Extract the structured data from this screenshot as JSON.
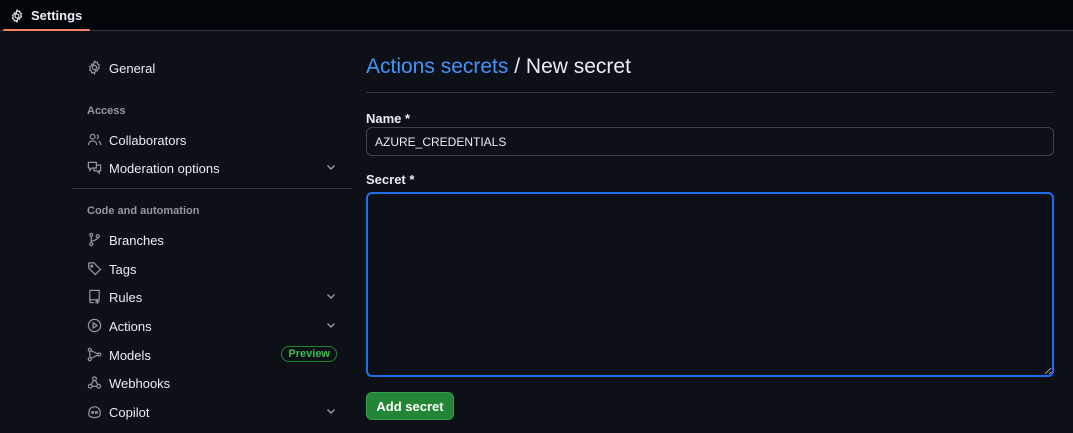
{
  "colors": {
    "background": "#0d1117",
    "accent_link": "#4493f8",
    "primary_button": "#238636",
    "focus_border": "#1f6feb",
    "tab_underline": "#f78166",
    "preview_badge": "#3fb950"
  },
  "topbar": {
    "tab_label": "Settings",
    "tab_icon": "gear-icon"
  },
  "sidebar": {
    "general": {
      "label": "General",
      "icon": "gear-icon"
    },
    "access_heading": "Access",
    "collaborators": {
      "label": "Collaborators",
      "icon": "people-icon"
    },
    "moderation": {
      "label": "Moderation options",
      "icon": "comment-discussion-icon"
    },
    "code_heading": "Code and automation",
    "branches": {
      "label": "Branches",
      "icon": "git-branch-icon"
    },
    "tags": {
      "label": "Tags",
      "icon": "tag-icon"
    },
    "rules": {
      "label": "Rules",
      "icon": "repo-push-icon"
    },
    "actions": {
      "label": "Actions",
      "icon": "play-icon"
    },
    "models": {
      "label": "Models",
      "icon": "models-icon",
      "badge": "Preview"
    },
    "webhooks": {
      "label": "Webhooks",
      "icon": "webhook-icon"
    },
    "copilot": {
      "label": "Copilot",
      "icon": "copilot-icon"
    }
  },
  "main": {
    "breadcrumb_link": "Actions secrets",
    "breadcrumb_separator": " / ",
    "breadcrumb_current": "New secret",
    "name_label": "Name *",
    "name_value": "AZURE_CREDENTIALS",
    "secret_label": "Secret *",
    "secret_value": "",
    "submit_label": "Add secret"
  }
}
